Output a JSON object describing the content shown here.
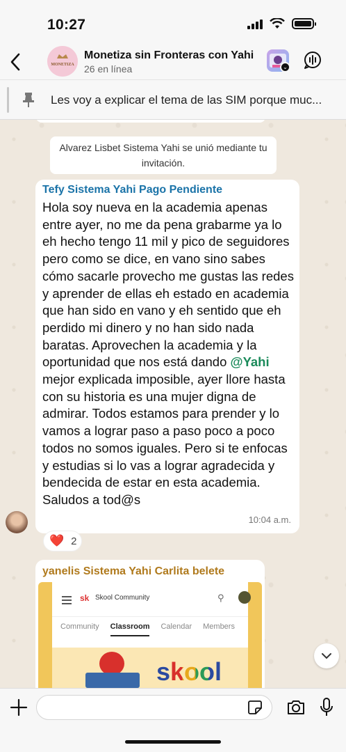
{
  "status": {
    "time": "10:27"
  },
  "header": {
    "title": "Monetiza sin Fronteras con Yahi",
    "subtitle": "26 en línea",
    "avatar_text": "MONETIZA"
  },
  "pinned": {
    "text": "Les voy a explicar el tema de las SIM porque muc..."
  },
  "messages": {
    "system": "Alvarez Lisbet Sistema Yahi se unió mediante tu invitación.",
    "m1": {
      "sender": "Tefy Sistema Yahi Pago Pendiente",
      "text_before": "Hola soy nueva en la academia apenas entre ayer, no me da pena grabarme ya lo eh hecho tengo 11 mil y pico de seguidores pero como se dice, en vano sino sabes cómo sacarle provecho me gustas las redes y aprender de ellas eh estado en academia que han sido en vano y eh sentido que eh perdido mi dinero y no han sido nada baratas. Aprovechen la academia y la oportunidad que nos está dando ",
      "mention": "@Yahi",
      "text_after": " mejor explicada imposible, ayer llore hasta con su historia es una mujer digna de admirar. Todos estamos para prender y lo vamos a lograr paso a paso poco a poco todos no somos iguales. Pero si te enfocas y estudias si lo vas a lograr agradecida y bendecida de estar en esta academia. Saludos a tod@s",
      "time": "10:04 a.m.",
      "reaction_emoji": "❤️",
      "reaction_count": "2"
    },
    "m2": {
      "sender": "yanelis Sistema Yahi Carlita belete",
      "media": {
        "logo": "sk",
        "name": "Skool Community",
        "tabs": [
          "Community",
          "Classroom",
          "Calendar",
          "Members"
        ],
        "hero_word": "skool"
      }
    }
  },
  "input": {
    "placeholder": ""
  },
  "colors": {
    "sender1": "#1a73a8",
    "sender2": "#b07a1d",
    "mention": "#1a8a5a"
  }
}
